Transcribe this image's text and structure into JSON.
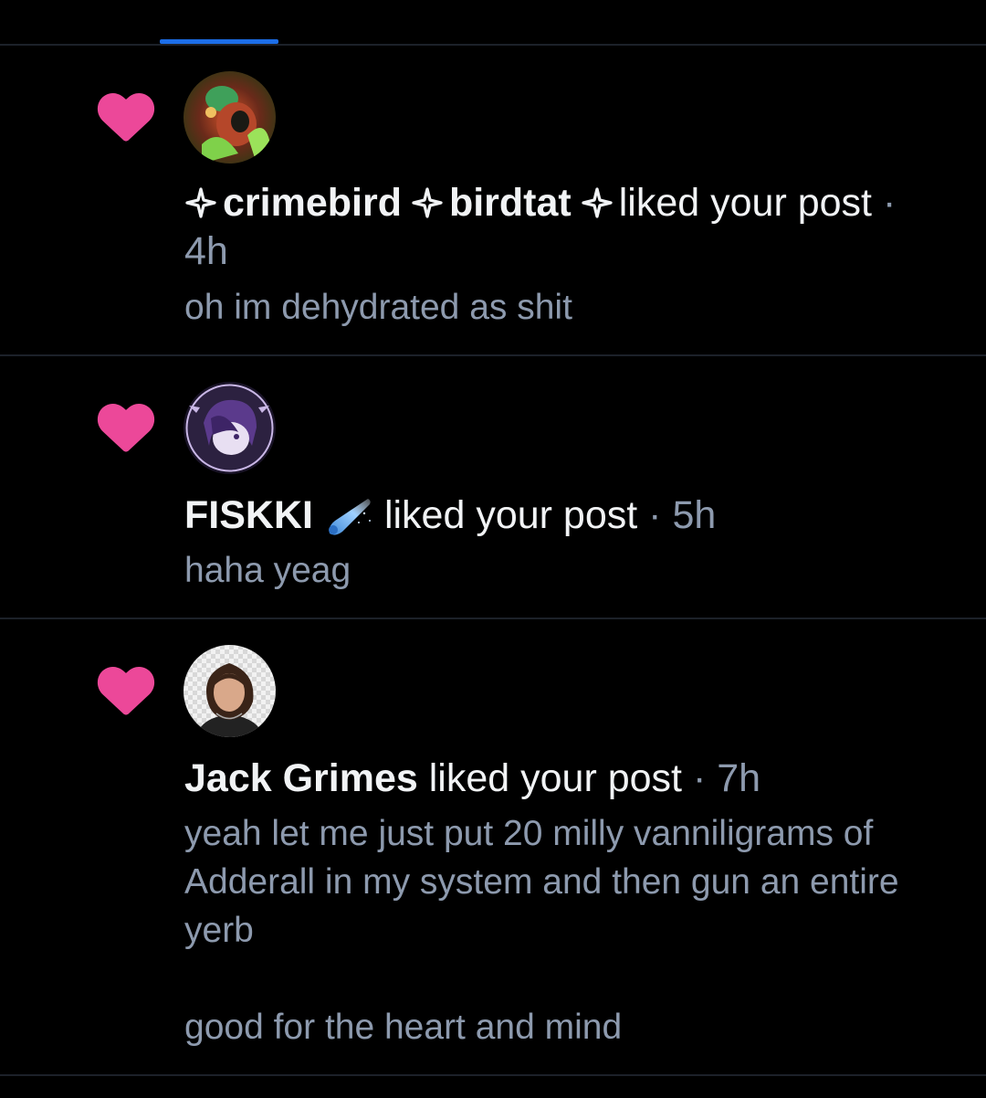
{
  "colors": {
    "background": "#000000",
    "divider": "#1c2129",
    "tab_indicator": "#1c6ee8",
    "heart": "#ec4899",
    "text_primary": "#f1f3f5",
    "text_secondary": "#8d9aae"
  },
  "notifications": [
    {
      "icon": "heart-icon",
      "name_parts": [
        "crimebird",
        "birdtat"
      ],
      "action": "liked your post",
      "separator": "·",
      "time": "4h",
      "snippet": "oh im dehydrated as shit"
    },
    {
      "icon": "heart-icon",
      "name": "FISKKI",
      "name_emoji": "comet-emoji",
      "action": "liked your post",
      "separator": "·",
      "time": "5h",
      "snippet": "haha yeag"
    },
    {
      "icon": "heart-icon",
      "name": "Jack Grimes",
      "action": "liked your post",
      "separator": "·",
      "time": "7h",
      "snippet": "yeah let me just put 20 milly vanniligrams of Adderall in my system and then gun an entire yerb\n\ngood for the heart and mind"
    }
  ]
}
